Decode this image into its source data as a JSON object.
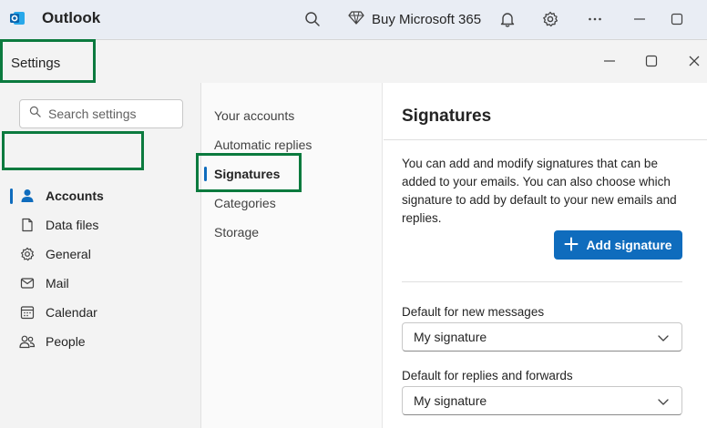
{
  "titlebar": {
    "app_name": "Outlook",
    "buy_label": "Buy Microsoft 365"
  },
  "dialog": {
    "title": "Settings"
  },
  "leftnav": {
    "search_placeholder": "Search settings",
    "items": [
      {
        "label": "Accounts",
        "icon": "person-icon",
        "active": true
      },
      {
        "label": "Data files",
        "icon": "document-icon"
      },
      {
        "label": "General",
        "icon": "gear-icon"
      },
      {
        "label": "Mail",
        "icon": "mail-icon"
      },
      {
        "label": "Calendar",
        "icon": "calendar-icon"
      },
      {
        "label": "People",
        "icon": "people-icon"
      }
    ]
  },
  "midnav": {
    "items": [
      {
        "label": "Your accounts"
      },
      {
        "label": "Automatic replies"
      },
      {
        "label": "Signatures",
        "active": true
      },
      {
        "label": "Categories"
      },
      {
        "label": "Storage"
      }
    ]
  },
  "main": {
    "title": "Signatures",
    "description": "You can add and modify signatures that can be added to your emails. You can also choose which signature to add by default to your new emails and replies.",
    "add_button": "Add signature",
    "default_new_label": "Default for new messages",
    "default_new_value": "My signature",
    "default_reply_label": "Default for replies and forwards",
    "default_reply_value": "My signature"
  },
  "colors": {
    "accent": "#0f6cbd",
    "highlight": "#0b7a3e"
  }
}
